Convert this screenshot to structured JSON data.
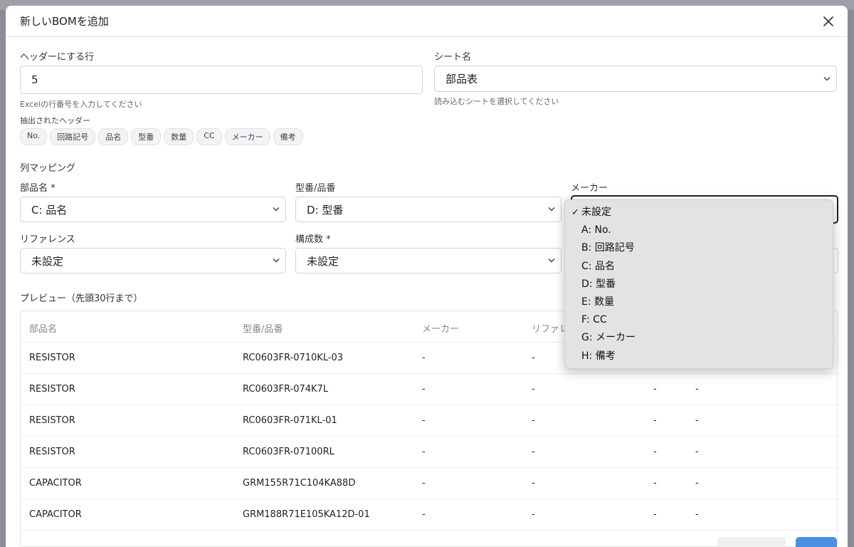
{
  "modal": {
    "title": "新しいBOMを追加",
    "close_icon": "close-icon"
  },
  "header_row": {
    "label": "ヘッダーにする行",
    "value": "5",
    "help": "Excelの行番号を入力してください"
  },
  "sheet": {
    "label": "シート名",
    "value": "部品表",
    "help": "読み込むシートを選択してください"
  },
  "extracted": {
    "label": "抽出されたヘッダー",
    "chips": [
      "No.",
      "回路記号",
      "品名",
      "型番",
      "数量",
      "CC",
      "メーカー",
      "備考"
    ]
  },
  "mapping": {
    "title": "列マッピング",
    "part_name": {
      "label": "部品名 *",
      "value": "C: 品名"
    },
    "model_no": {
      "label": "型番/品番",
      "value": "D: 型番"
    },
    "maker": {
      "label": "メーカー"
    },
    "reference": {
      "label": "リファレンス",
      "value": "未設定"
    },
    "quantity": {
      "label": "構成数 *",
      "value": "未設定"
    }
  },
  "dropdown": {
    "selected_mark": "✓",
    "options": [
      "未設定",
      "A: No.",
      "B: 回路記号",
      "C: 品名",
      "D: 型番",
      "E: 数量",
      "F: CC",
      "G: メーカー",
      "H: 備考"
    ]
  },
  "preview": {
    "title": "プレビュー（先頭30行まで）",
    "headers": [
      "部品名",
      "型番/品番",
      "メーカー",
      "リファレ"
    ],
    "rows": [
      [
        "RESISTOR",
        "RC0603FR-0710KL-03",
        "-",
        "-",
        "",
        ""
      ],
      [
        "RESISTOR",
        "RC0603FR-074K7L",
        "-",
        "-",
        "-",
        "-"
      ],
      [
        "RESISTOR",
        "RC0603FR-071KL-01",
        "-",
        "-",
        "-",
        "-"
      ],
      [
        "RESISTOR",
        "RC0603FR-07100RL",
        "-",
        "-",
        "-",
        "-"
      ],
      [
        "CAPACITOR",
        "GRM155R71C104KA88D",
        "-",
        "-",
        "-",
        "-"
      ],
      [
        "CAPACITOR",
        "GRM188R71E105KA12D-01",
        "-",
        "-",
        "-",
        "-"
      ]
    ]
  },
  "colors": {
    "accent": "#4a90e2",
    "dropdown_bg": "#e3e3e3"
  }
}
